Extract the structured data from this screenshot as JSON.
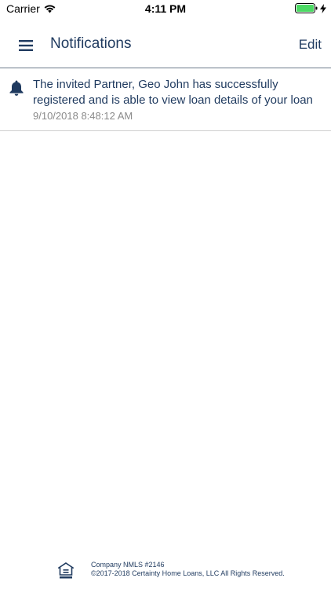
{
  "status_bar": {
    "carrier": "Carrier",
    "time": "4:11 PM",
    "icons": [
      "wifi-icon",
      "battery-icon",
      "charging-bolt-icon"
    ]
  },
  "nav": {
    "title": "Notifications",
    "edit_label": "Edit",
    "menu_icon": "hamburger-menu-icon"
  },
  "notifications": [
    {
      "icon": "bell-icon",
      "message": "The invited Partner,  Geo John has successfully registered and is able to view loan details of your loan",
      "timestamp": "9/10/2018 8:48:12 AM"
    }
  ],
  "footer": {
    "icon": "equal-housing-lender-icon",
    "nmls": "Company NMLS #2146",
    "copyright": "©2017-2018 Certainty Home Loans, LLC All Rights Reserved."
  },
  "colors": {
    "primary_text": "#1f3a5f",
    "timestamp_text": "#8a8a8a",
    "battery_green": "#4cd964",
    "divider": "#6d7b8c"
  }
}
